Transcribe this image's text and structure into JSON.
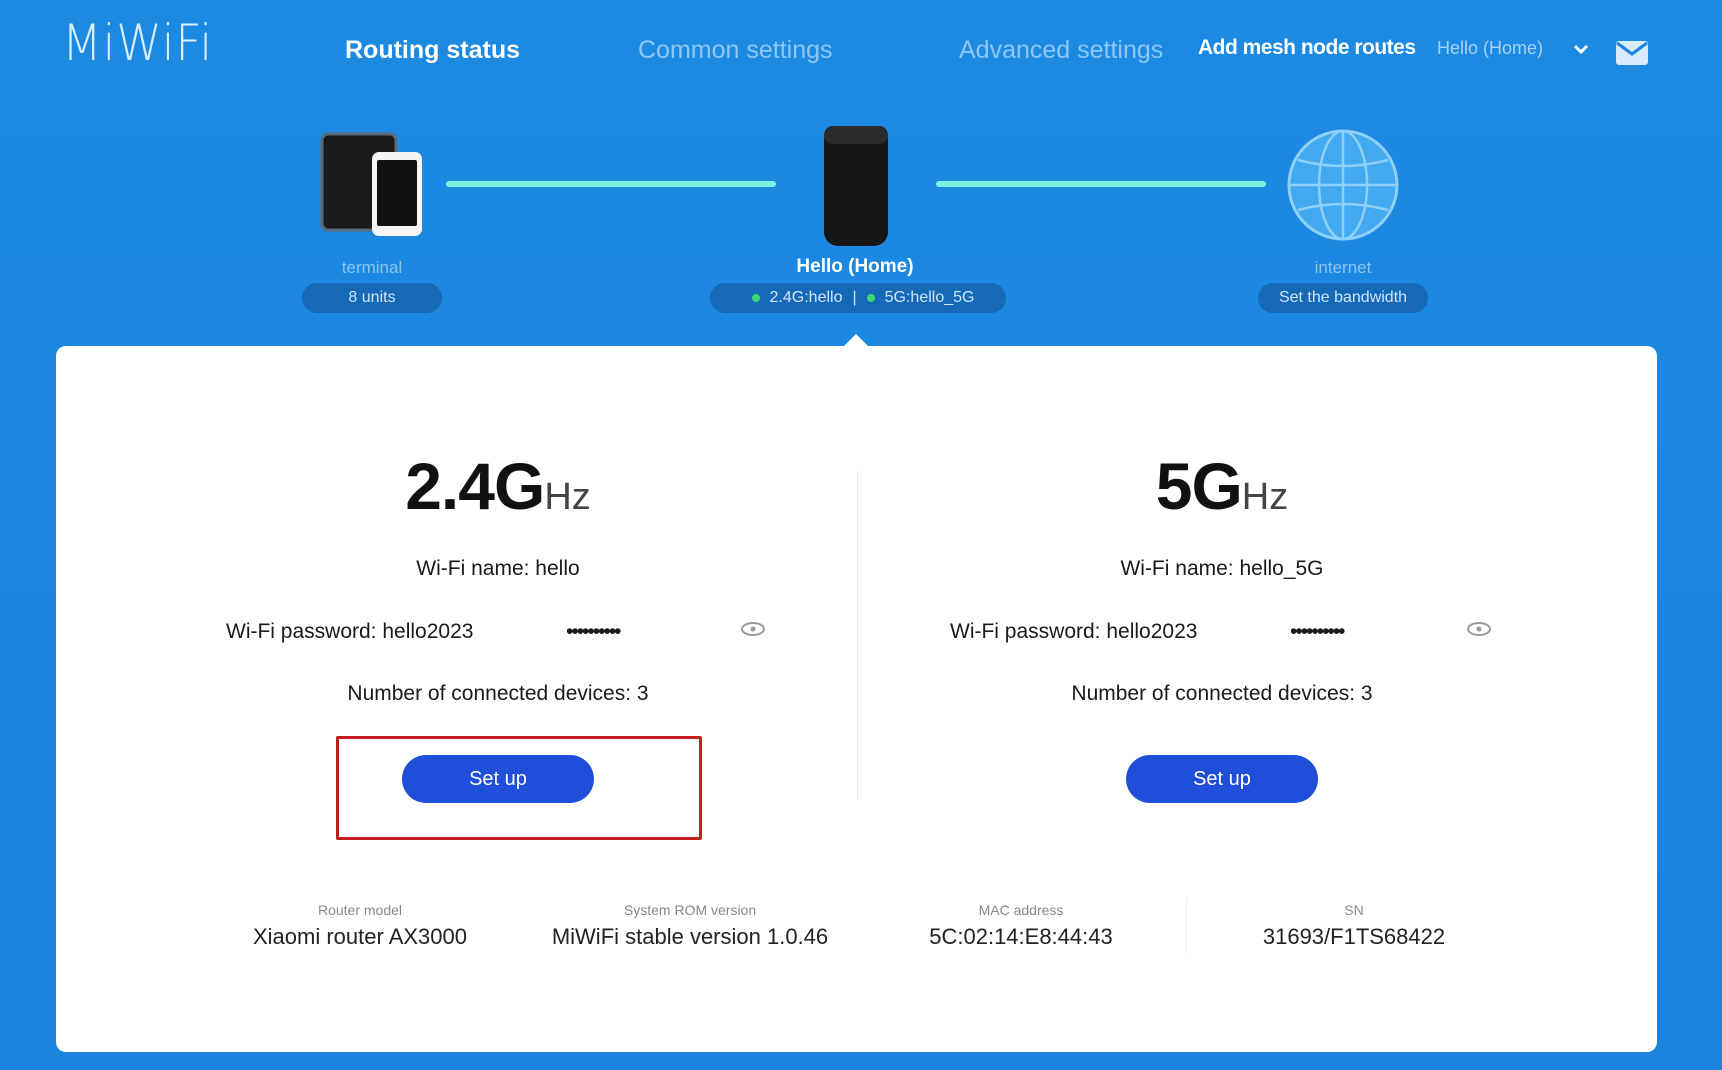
{
  "header": {
    "logo": "MiWiFi",
    "nav": [
      "Routing status",
      "Common settings",
      "Advanced settings"
    ],
    "mesh_link": "Add mesh node routes",
    "user": "Hello (Home)"
  },
  "topology": {
    "terminal": {
      "label": "terminal",
      "badge": "8 units"
    },
    "router": {
      "label": "Hello (Home)",
      "band24": "2.4G:hello",
      "band5": "5G:hello_5G",
      "separator": "|"
    },
    "internet": {
      "label": "internet",
      "badge": "Set the bandwidth"
    }
  },
  "bands": [
    {
      "freq": "2.4G",
      "unit": "Hz",
      "wifi_name": "Wi-Fi name: hello",
      "password_label": "Wi-Fi password: hello2023",
      "password_mask": "••••••••••",
      "devices": "Number of connected devices: 3",
      "button": "Set up"
    },
    {
      "freq": "5G",
      "unit": "Hz",
      "wifi_name": "Wi-Fi name: hello_5G",
      "password_label": "Wi-Fi password: hello2023",
      "password_mask": "••••••••••",
      "devices": "Number of connected devices: 3",
      "button": "Set up"
    }
  ],
  "info": [
    {
      "label": "Router model",
      "value": "Xiaomi router AX3000"
    },
    {
      "label": "System ROM version",
      "value": "MiWiFi stable version 1.0.46"
    },
    {
      "label": "MAC address",
      "value": "5C:02:14:E8:44:43"
    },
    {
      "label": "SN",
      "value": "31693/F1TS68422"
    }
  ],
  "colors": {
    "background": "#1a84de",
    "accent_line": "#7cf0e0",
    "button": "#1f4fd8",
    "highlight_box": "#c41c1c",
    "status_dot": "#3dd872"
  }
}
